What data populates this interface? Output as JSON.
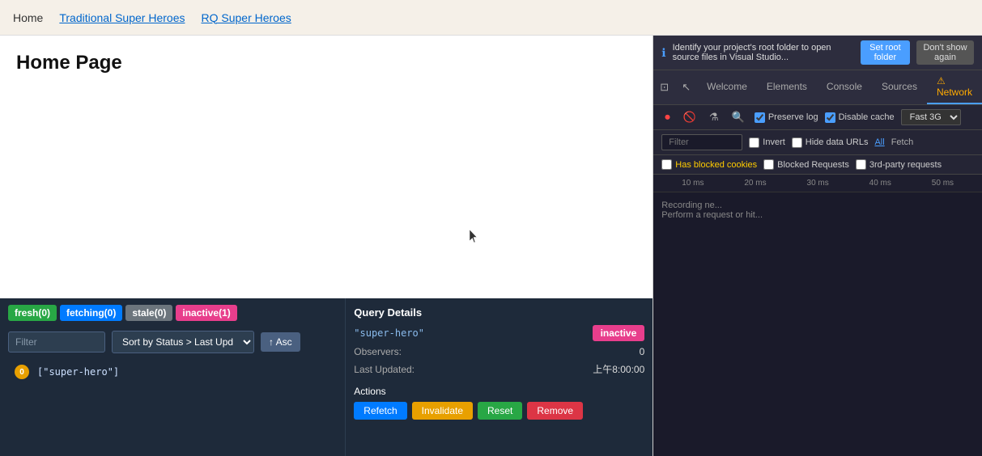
{
  "nav": {
    "links": [
      {
        "label": "Home",
        "active": true
      },
      {
        "label": "Traditional Super Heroes",
        "active": false
      },
      {
        "label": "RQ Super Heroes",
        "active": false
      }
    ]
  },
  "page": {
    "title": "Home Page"
  },
  "query_panel": {
    "badges": [
      {
        "label": "fresh(0)",
        "type": "fresh"
      },
      {
        "label": "fetching(0)",
        "type": "fetching"
      },
      {
        "label": "stale(0)",
        "type": "stale"
      },
      {
        "label": "inactive(1)",
        "type": "inactive"
      }
    ],
    "filter_placeholder": "Filter",
    "sort_label": "Sort by Status > Last Upd",
    "asc_label": "↑ Asc",
    "query_row": {
      "number": "0",
      "key": "[\"super-hero\"]"
    }
  },
  "query_details": {
    "title": "Query Details",
    "key": "\"super-hero\"",
    "status": "inactive",
    "observers_label": "Observers:",
    "observers_value": "0",
    "last_updated_label": "Last Updated:",
    "last_updated_value": "上午8:00:00",
    "actions_label": "Actions",
    "btn_refetch": "Refetch",
    "btn_invalidate": "Invalidate",
    "btn_reset": "Reset",
    "btn_remove": "Remove"
  },
  "devtools": {
    "info_text": "Identify your project's root folder to open source files in Visual Studio...",
    "set_root_label": "Set root folder",
    "dont_show_label": "Don't show again",
    "tabs": [
      "Welcome",
      "Elements",
      "Console",
      "Sources",
      "Network"
    ],
    "active_tab": "Network",
    "preserve_log_label": "Preserve log",
    "disable_cache_label": "Disable cache",
    "throttle_label": "Fast 3G",
    "filter_placeholder": "Filter",
    "invert_label": "Invert",
    "hide_data_urls_label": "Hide data URLs",
    "all_label": "All",
    "fetch_label": "Fetch",
    "has_blocked_cookies_label": "Has blocked cookies",
    "blocked_requests_label": "Blocked Requests",
    "third_party_label": "3rd-party requests",
    "timeline_ticks": [
      "10 ms",
      "20 ms",
      "30 ms",
      "40 ms",
      "50 ms"
    ],
    "recording_text": "Recording ne...",
    "recording_sub": "Perform a request or hit..."
  }
}
